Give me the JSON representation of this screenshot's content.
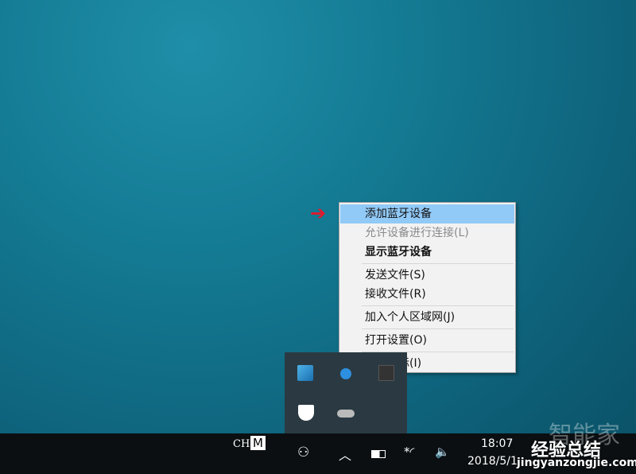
{
  "context_menu": {
    "items": [
      {
        "label": "添加蓝牙设备",
        "state": "highlighted"
      },
      {
        "label": "允许设备进行连接(L)",
        "state": "disabled"
      },
      {
        "label": "显示蓝牙设备",
        "state": "bold"
      },
      {
        "label": "发送文件(S)"
      },
      {
        "label": "接收文件(R)"
      },
      {
        "label": "加入个人区域网(J)"
      },
      {
        "label": "打开设置(O)"
      },
      {
        "label": "删除图标(I)"
      }
    ]
  },
  "taskbar": {
    "lang": "CH",
    "ime": "M",
    "time": "18:07",
    "date": "2018/5/1"
  },
  "watermark": {
    "brand": "智能家",
    "cn": "经验总结",
    "url": "jingyanzongjie.com"
  },
  "colors": {
    "highlight": "#91c9f7",
    "arrow": "#e0192b",
    "taskbar": "#0b0f12"
  }
}
